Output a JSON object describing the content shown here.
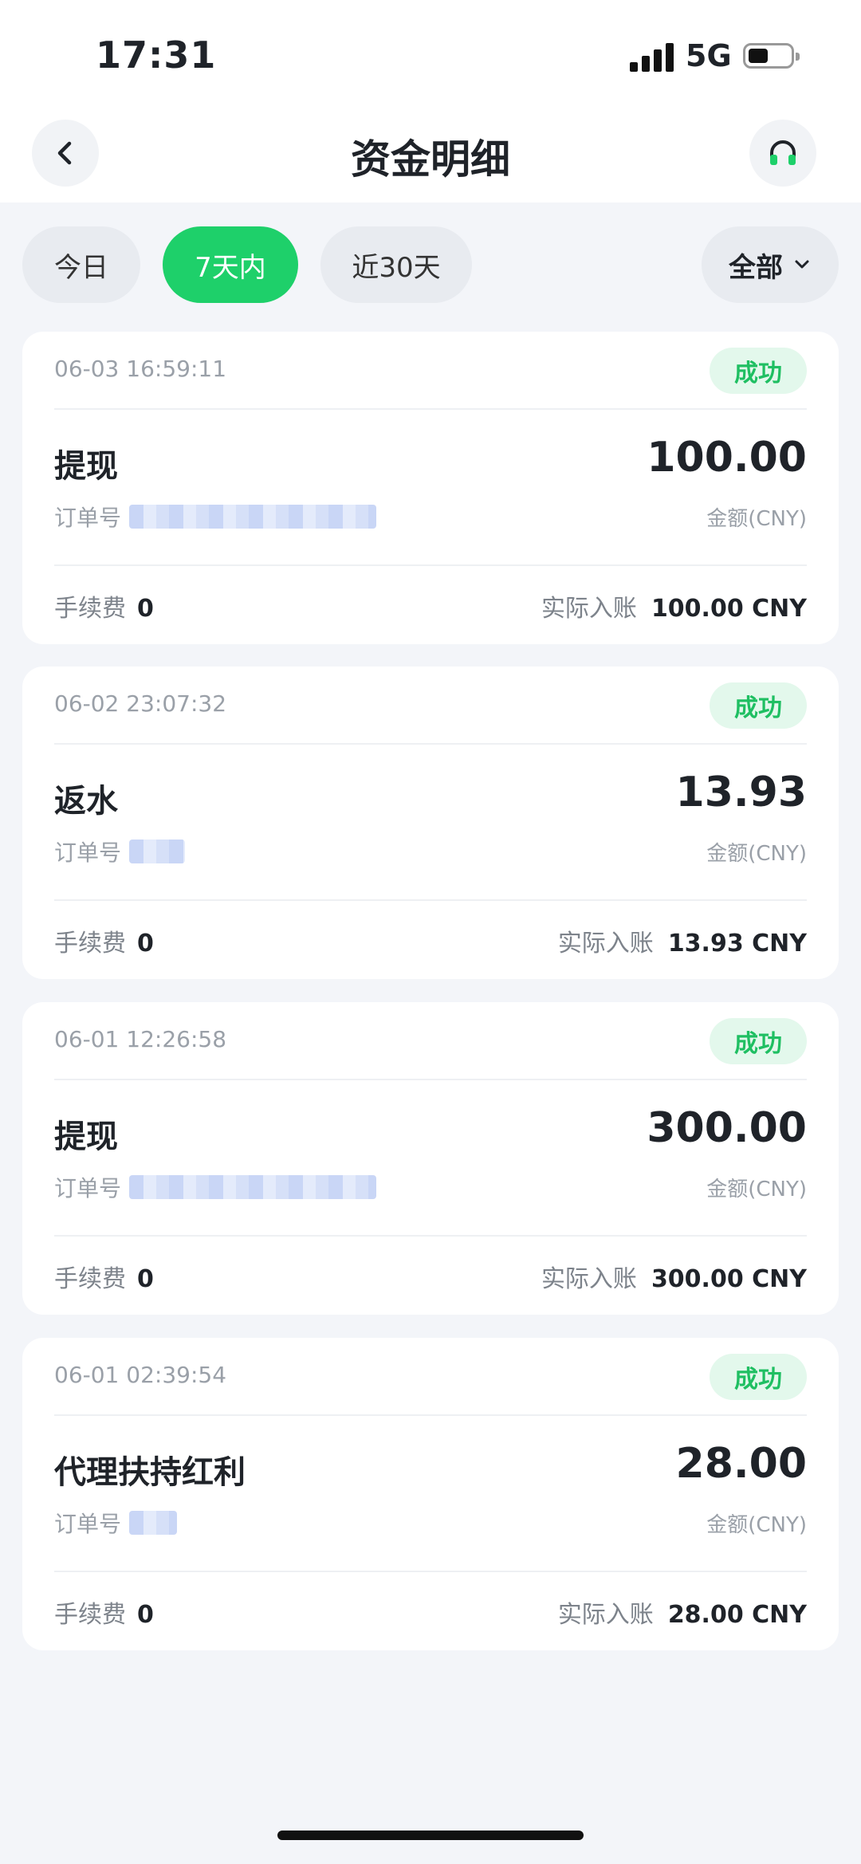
{
  "status_bar": {
    "time": "17:31",
    "network": "5G"
  },
  "header": {
    "title": "资金明细"
  },
  "filters": {
    "today": "今日",
    "seven_days": "7天内",
    "thirty_days": "近30天",
    "all": "全部"
  },
  "records": [
    {
      "date": "06-03 16:59:11",
      "status": "成功",
      "type": "提现",
      "order_label": "订单号",
      "amount": "100.00",
      "amount_label": "金额(CNY)",
      "fee_label": "手续费",
      "fee": "0",
      "actual_label": "实际入账",
      "actual": "100.00 CNY"
    },
    {
      "date": "06-02 23:07:32",
      "status": "成功",
      "type": "返水",
      "order_label": "订单号",
      "amount": "13.93",
      "amount_label": "金额(CNY)",
      "fee_label": "手续费",
      "fee": "0",
      "actual_label": "实际入账",
      "actual": "13.93 CNY"
    },
    {
      "date": "06-01 12:26:58",
      "status": "成功",
      "type": "提现",
      "order_label": "订单号",
      "amount": "300.00",
      "amount_label": "金额(CNY)",
      "fee_label": "手续费",
      "fee": "0",
      "actual_label": "实际入账",
      "actual": "300.00 CNY"
    },
    {
      "date": "06-01 02:39:54",
      "status": "成功",
      "type": "代理扶持红利",
      "order_label": "订单号",
      "amount": "28.00",
      "amount_label": "金额(CNY)",
      "fee_label": "手续费",
      "fee": "0",
      "actual_label": "实际入账",
      "actual": "28.00 CNY"
    }
  ],
  "icons": {
    "back": "chevron-left-icon",
    "support": "headphones-icon",
    "dropdown": "chevron-down-icon"
  },
  "colors": {
    "accent": "#1ed06a",
    "success_text": "#1fbf62",
    "success_bg": "#e3f8ec"
  }
}
